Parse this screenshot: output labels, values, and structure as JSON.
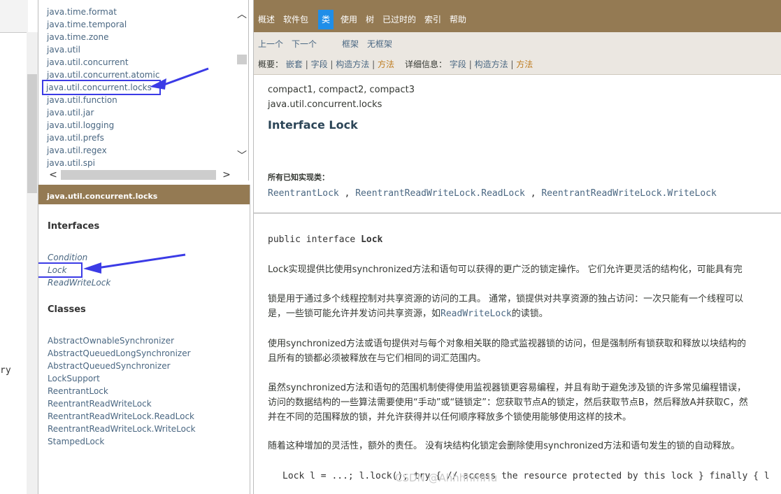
{
  "left_frame": {
    "cut_text": "ry"
  },
  "packages": {
    "items": [
      "java.time.format",
      "java.time.temporal",
      "java.time.zone",
      "java.util",
      "java.util.concurrent",
      "java.util.concurrent.atomic",
      "java.util.concurrent.locks",
      "java.util.function",
      "java.util.jar",
      "java.util.logging",
      "java.util.prefs",
      "java.util.regex",
      "java.util.spi"
    ],
    "selected_index": 6,
    "scroll_up": "︿",
    "scroll_down": "﹀",
    "scroll_left": "<",
    "scroll_right": ">"
  },
  "classes_frame": {
    "header": "java.util.concurrent.locks",
    "interfaces_heading": "Interfaces",
    "interfaces": [
      "Condition",
      "Lock",
      "ReadWriteLock"
    ],
    "selected_interface": "Lock",
    "classes_heading": "Classes",
    "classes": [
      "AbstractOwnableSynchronizer",
      "AbstractQueuedLongSynchronizer",
      "AbstractQueuedSynchronizer",
      "LockSupport",
      "ReentrantLock",
      "ReentrantReadWriteLock",
      "ReentrantReadWriteLock.ReadLock",
      "ReentrantReadWriteLock.WriteLock",
      "StampedLock"
    ]
  },
  "topnav": {
    "items": [
      "概述",
      "软件包",
      "类",
      "使用",
      "树",
      "已过时的",
      "索引",
      "帮助"
    ],
    "active": "类"
  },
  "subnav": {
    "prev": "上一个",
    "next": "下一个",
    "frames": "框架",
    "no_frames": "无框架",
    "summary_label": "概要：",
    "summary_nested": "嵌套",
    "summary_field": "字段",
    "summary_constructor": "构造方法",
    "summary_method": "方法",
    "detail_label": "详细信息：",
    "detail_field": "字段",
    "detail_constructor": "构造方法",
    "detail_method": "方法",
    "separator": "|"
  },
  "main": {
    "profiles": "compact1, compact2, compact3",
    "package": "java.util.concurrent.locks",
    "title": "Interface Lock",
    "known_impl_label": "所有已知实现类：",
    "known_impl": [
      "ReentrantLock",
      "ReentrantReadWriteLock.ReadLock",
      "ReentrantReadWriteLock.WriteLock"
    ],
    "comma": ",",
    "declaration_prefix": "public interface ",
    "declaration_name": "Lock",
    "p1": "Lock实现提供比使用synchronized方法和语句可以获得的更广泛的锁定操作。 它们允许更灵活的结构化，可能具有完",
    "p2_line1": "锁是用于通过多个线程控制对共享资源的访问的工具。 通常，锁提供对共享资源的独占访问：一次只能有一个线程可以",
    "p2_line2_a": "是，一些锁可能允许并发访问共享资源，如",
    "p2_line2_link": "ReadWriteLock",
    "p2_line2_b": "的读锁。",
    "p3_line1": "使用synchronized方法或语句提供对与每个对象相关联的隐式监视器锁的访问，但是强制所有锁获取和释放以块结构的",
    "p3_line2": "且所有的锁都必须被释放在与它们相同的词汇范围内。",
    "p4_line1": "虽然synchronized方法和语句的范围机制使得使用监视器锁更容易编程，并且有助于避免涉及锁的许多常见编程错误，",
    "p4_line2": "访问的数据结构的一些算法需要使用“手动”或“链锁定”：您获取节点A的锁定，然后获取节点B，然后释放A并获取C，然",
    "p4_line3": "并在不同的范围释放的锁，并允许获得并以任何顺序释放多个锁使用能够使用这样的技术。",
    "p5": "随着这种增加的灵活性，额外的责任。 没有块结构化锁定会删除使用synchronized方法和语句发生的锁的自动释放。",
    "code": "Lock l = ...; l.lock(); try { // access the resource protected by this lock } finally { l"
  },
  "watermark": "CSDN @AhhhhmHu",
  "colors": {
    "nav_bg": "#947a53",
    "active_nav": "#1f8ee8",
    "link": "#4a6782",
    "annotation": "#3b3be6"
  }
}
